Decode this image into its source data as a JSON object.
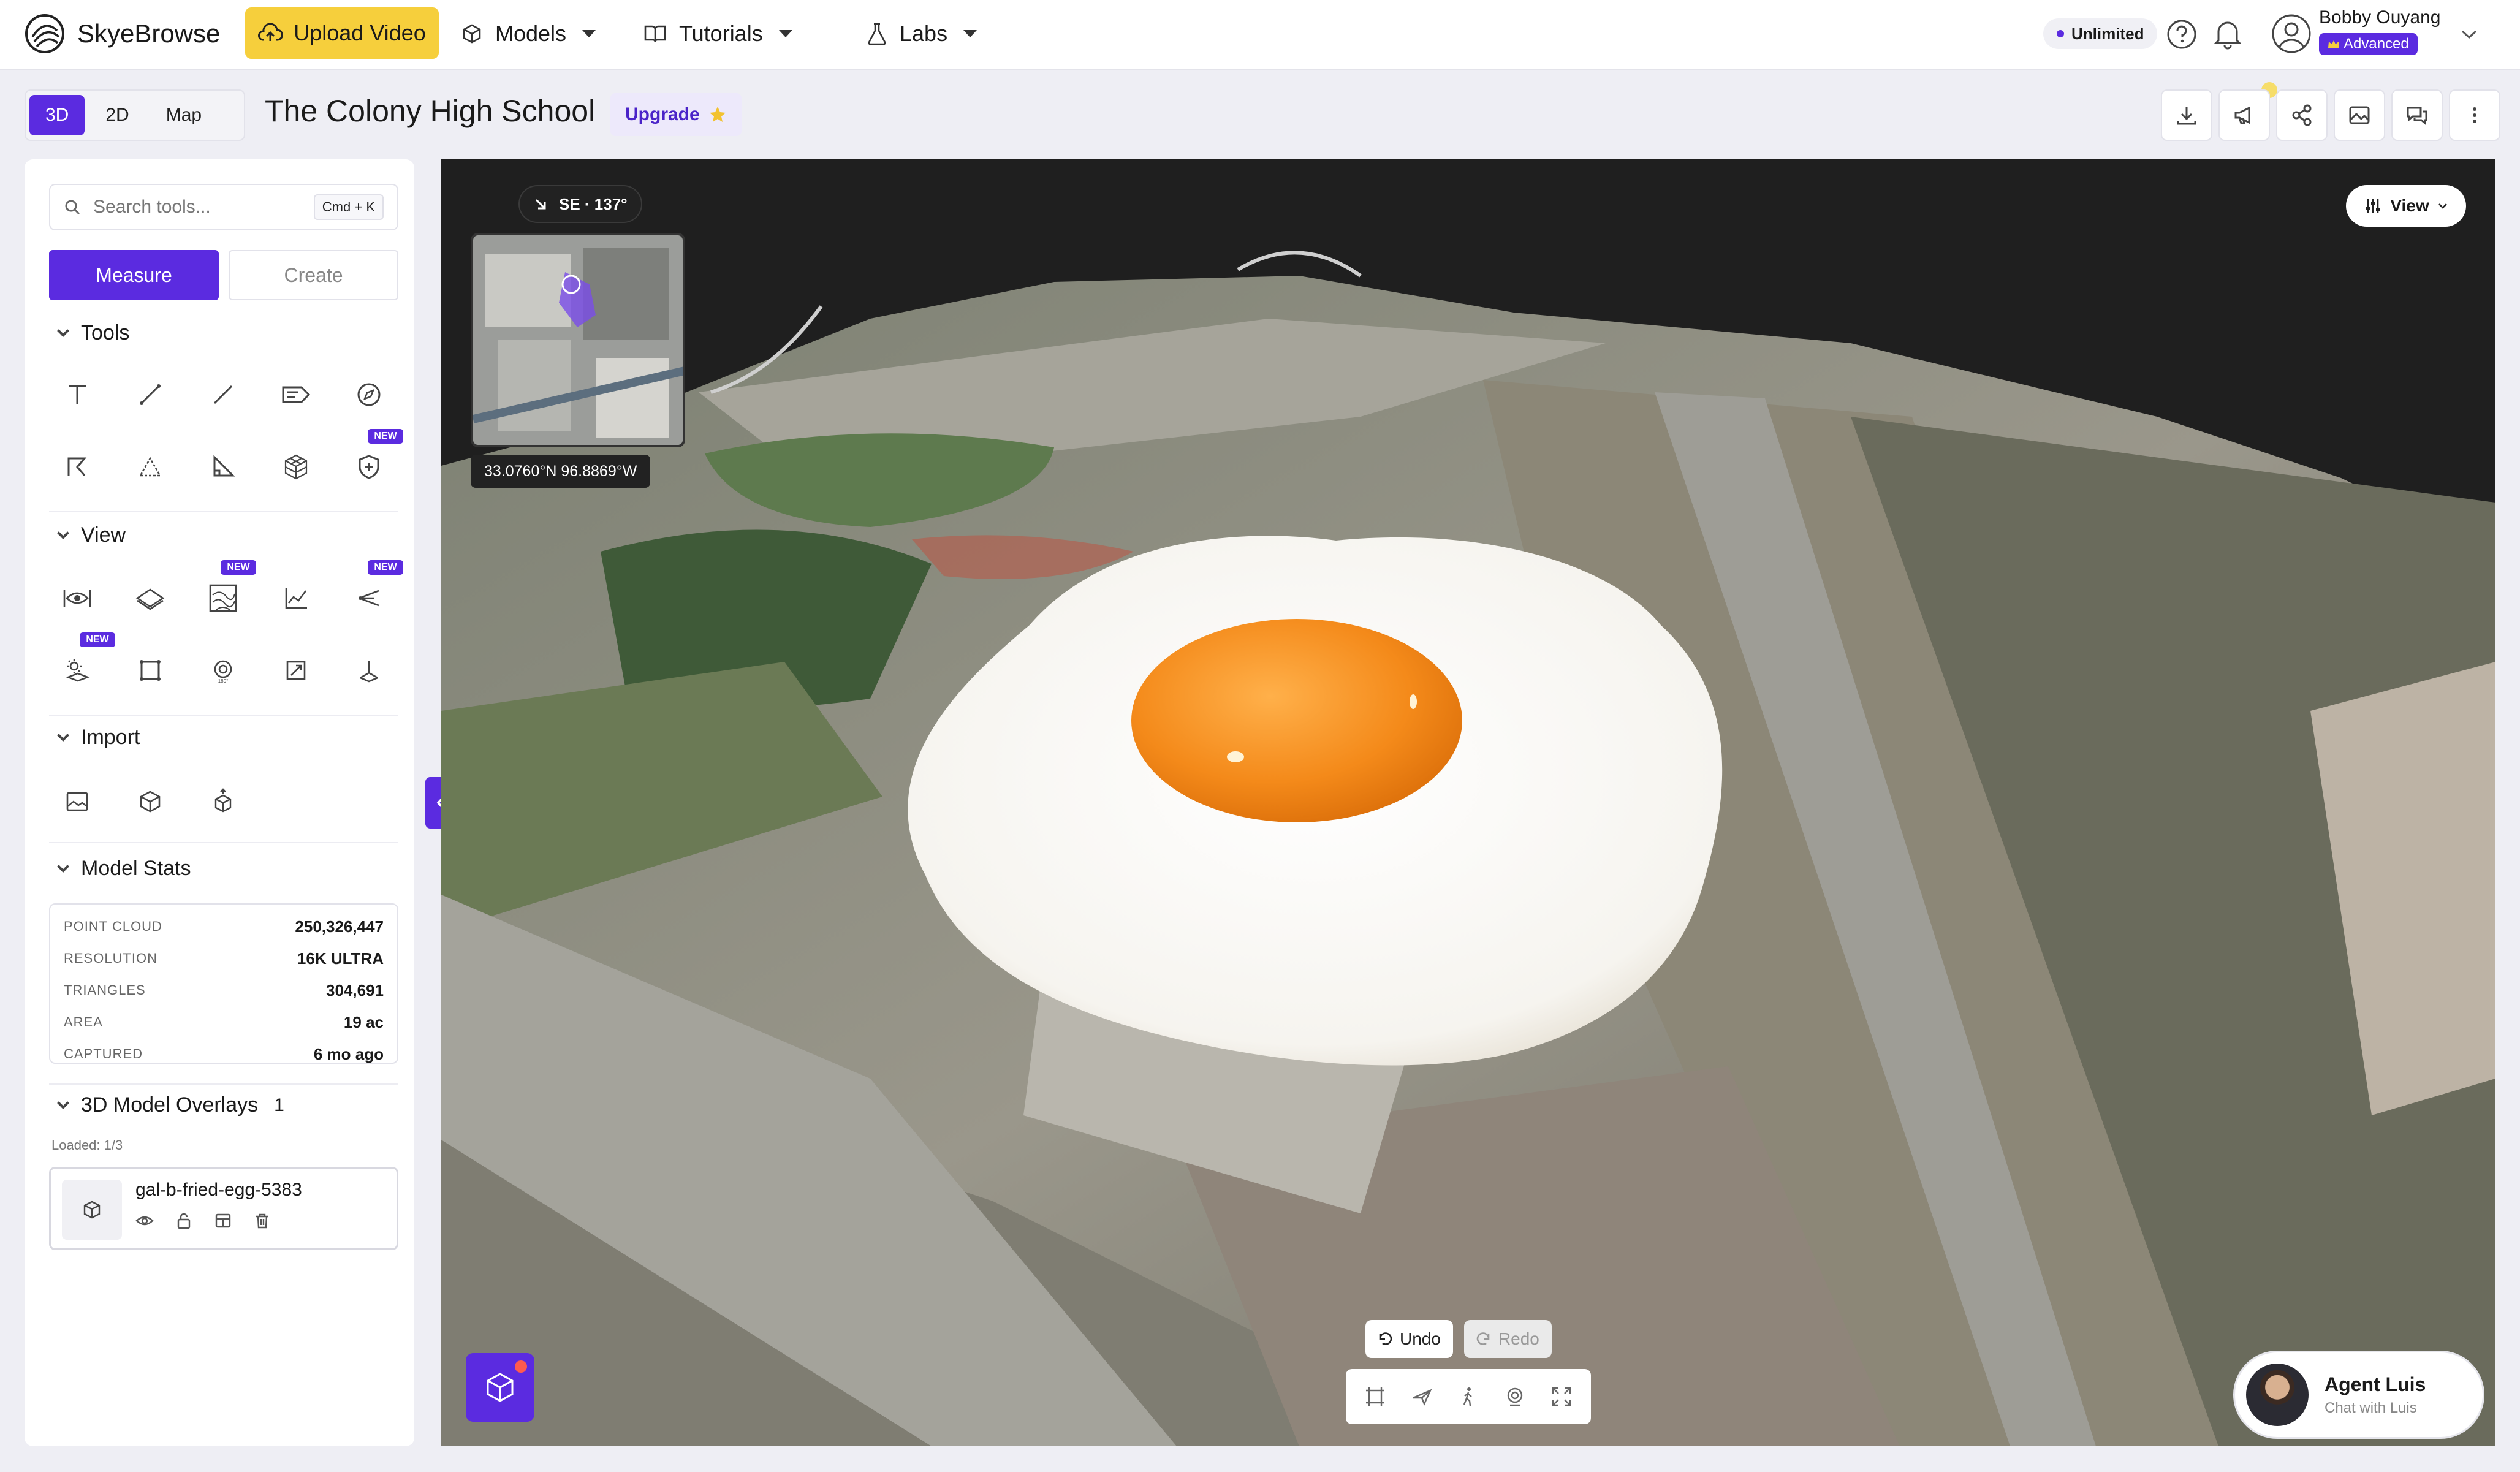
{
  "brand": {
    "name": "SkyeBrowse"
  },
  "topbar": {
    "upload_label": "Upload Video",
    "nav": [
      {
        "label": "Models"
      },
      {
        "label": "Tutorials"
      },
      {
        "label": "Labs"
      }
    ],
    "plan_badge": "Unlimited",
    "user_name": "Bobby Ouyang",
    "user_tier": "Advanced"
  },
  "modes": [
    {
      "label": "3D",
      "active": true
    },
    {
      "label": "2D"
    },
    {
      "label": "Map"
    }
  ],
  "project": {
    "title": "The Colony High School",
    "upgrade_label": "Upgrade"
  },
  "sidebar": {
    "search": {
      "placeholder": "Search tools...",
      "shortcut": "Cmd + K"
    },
    "segments": [
      {
        "label": "Measure",
        "active": true
      },
      {
        "label": "Create"
      }
    ],
    "sections": {
      "tools": "Tools",
      "view": "View",
      "import": "Import",
      "stats": "Model Stats",
      "overlays": "3D Model Overlays"
    },
    "new_badge": "NEW",
    "stats": [
      {
        "key": "POINT CLOUD",
        "value": "250,326,447"
      },
      {
        "key": "RESOLUTION",
        "value": "16K ULTRA"
      },
      {
        "key": "TRIANGLES",
        "value": "304,691"
      },
      {
        "key": "AREA",
        "value": "19 ac"
      },
      {
        "key": "CAPTURED",
        "value": "6 mo ago"
      }
    ],
    "overlay_count": "1",
    "loaded": "Loaded: 1/3",
    "overlay_name": "gal-b-fried-egg-5383"
  },
  "viewport": {
    "direction": "SE · 137°",
    "coords": "33.0760°N 96.8869°W",
    "view_label": "View",
    "undo_label": "Undo",
    "redo_label": "Redo"
  },
  "agent": {
    "name": "Agent Luis",
    "subtitle": "Chat with Luis"
  },
  "colors": {
    "accent": "#5b2be0",
    "upload": "#f6cf3c"
  }
}
